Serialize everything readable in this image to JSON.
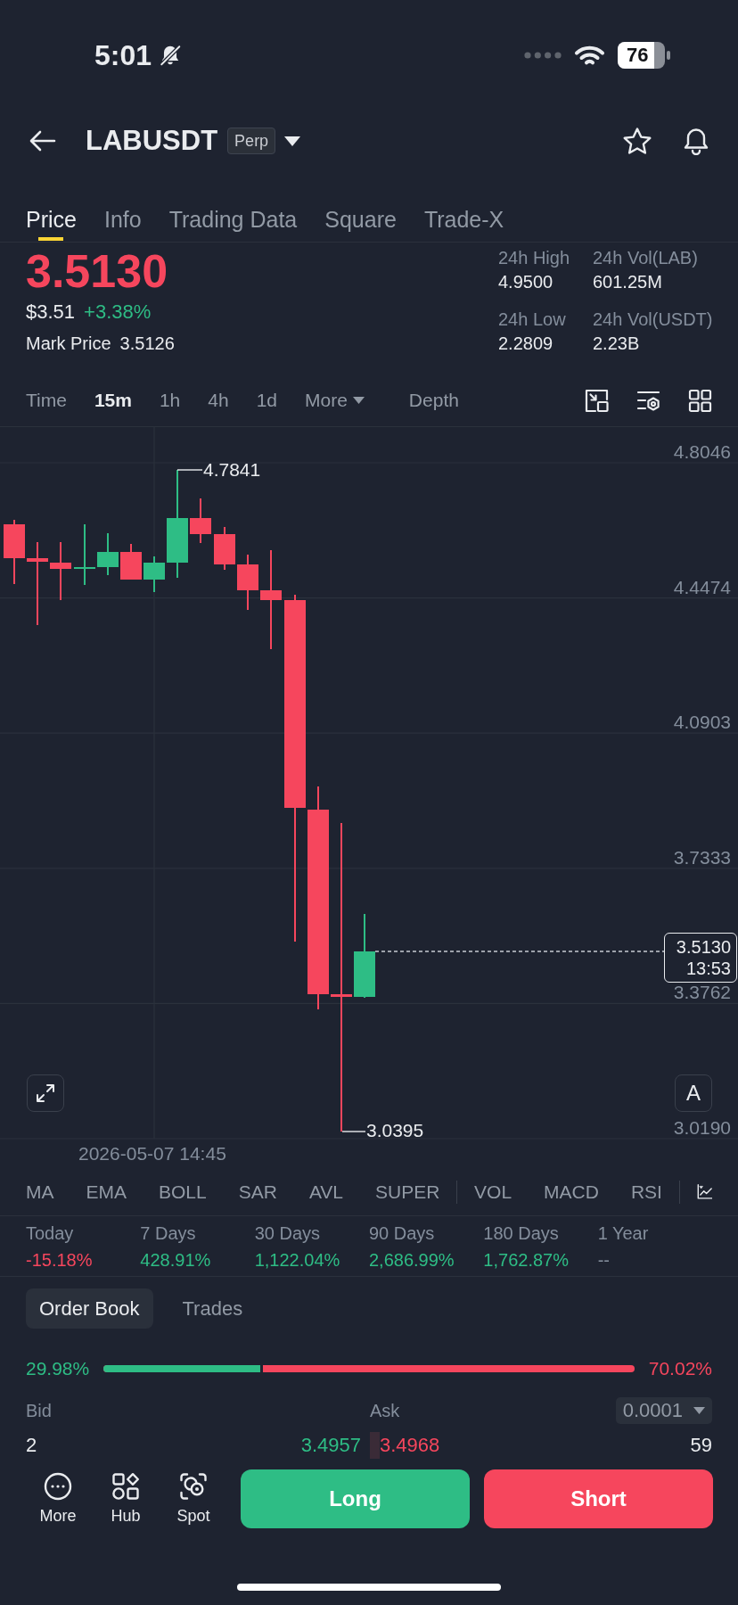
{
  "status_bar": {
    "time": "5:01",
    "battery": "76"
  },
  "header": {
    "title": "LABUSDT",
    "badge": "Perp"
  },
  "tabs": [
    {
      "label": "Price",
      "selected": true
    },
    {
      "label": "Info",
      "selected": false
    },
    {
      "label": "Trading Data",
      "selected": false
    },
    {
      "label": "Square",
      "selected": false
    },
    {
      "label": "Trade-X",
      "selected": false
    }
  ],
  "ticker": {
    "last_price": "3.5130",
    "last_price_falling": true,
    "usd_price": "$3.51",
    "change": "+3.38%",
    "change_rising": true,
    "mark_price_label": "Mark Price",
    "mark_price": "3.5126",
    "stats": [
      {
        "label": "24h High",
        "value": "4.9500"
      },
      {
        "label": "24h Vol(LAB)",
        "value": "601.25M"
      },
      {
        "label": "24h Low",
        "value": "2.2809"
      },
      {
        "label": "24h Vol(USDT)",
        "value": "2.23B"
      }
    ]
  },
  "intervals": [
    {
      "label": "Time",
      "kind": "interval",
      "selected": false
    },
    {
      "label": "15m",
      "kind": "interval",
      "selected": true
    },
    {
      "label": "1h",
      "kind": "interval",
      "selected": false
    },
    {
      "label": "4h",
      "kind": "interval",
      "selected": false
    },
    {
      "label": "1d",
      "kind": "interval",
      "selected": false
    },
    {
      "label": "More",
      "kind": "menu",
      "selected": false
    },
    {
      "label": "Depth",
      "kind": "view",
      "selected": false
    }
  ],
  "chart": {
    "price_axis": [
      "4.8046",
      "4.4474",
      "4.0903",
      "3.7333",
      "3.3762",
      "3.0190"
    ],
    "high_label": "4.7841",
    "low_label": "3.0395",
    "last_price": "3.5130",
    "countdown": "13:53",
    "scale_button": "A",
    "time_label": "2026-05-07 14:45"
  },
  "indicators": {
    "main": [
      "MA",
      "EMA",
      "BOLL",
      "SAR",
      "AVL",
      "SUPER"
    ],
    "sub": [
      "VOL",
      "MACD",
      "RSI"
    ]
  },
  "performance": [
    {
      "label": "Today",
      "value": "-15.18%",
      "color": "#f6465d"
    },
    {
      "label": "7 Days",
      "value": "428.91%",
      "color": "#2ebd85"
    },
    {
      "label": "30 Days",
      "value": "1,122.04%",
      "color": "#2ebd85"
    },
    {
      "label": "90 Days",
      "value": "2,686.99%",
      "color": "#2ebd85"
    },
    {
      "label": "180 Days",
      "value": "1,762.87%",
      "color": "#2ebd85"
    },
    {
      "label": "1 Year",
      "value": "--",
      "color": "#848e9c"
    }
  ],
  "order_book": {
    "tabs": [
      {
        "label": "Order Book",
        "selected": true
      },
      {
        "label": "Trades",
        "selected": false
      }
    ],
    "bid_share": "29.98%",
    "ask_share": "70.02%",
    "level": 0.2998,
    "bid_label": "Bid",
    "ask_label": "Ask",
    "precision": "0.0001",
    "rows": [
      {
        "bid_qty": "2",
        "bid_price": "3.4957",
        "ask_price": "3.4968",
        "ask_qty": "59"
      }
    ]
  },
  "bottom_bar": {
    "shortcuts": [
      {
        "label": "More",
        "kind": "more"
      },
      {
        "label": "Hub",
        "kind": "hub"
      },
      {
        "label": "Spot",
        "kind": "spot"
      }
    ],
    "long_button": "Long",
    "short_button": "Short"
  }
}
